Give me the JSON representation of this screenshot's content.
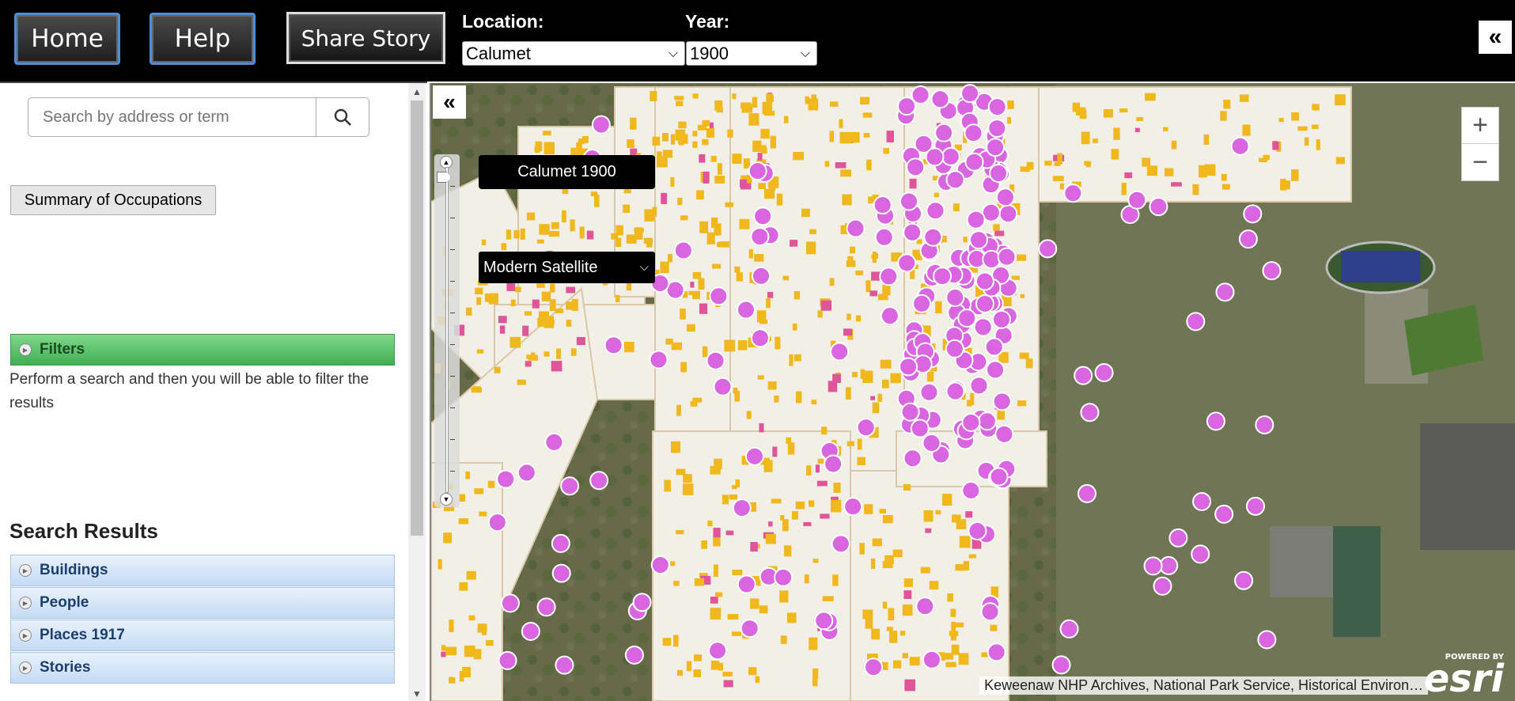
{
  "header": {
    "home_label": "Home",
    "help_label": "Help",
    "share_label": "Share Story",
    "location_label": "Location:",
    "location_value": "Calumet",
    "year_label": "Year:",
    "year_value": "1900",
    "collapse_icon": "double-chevron-left-icon"
  },
  "sidebar": {
    "search_placeholder": "Search by address or term",
    "summary_button": "Summary of Occupations",
    "filters_label": "Filters",
    "filters_message": "Perform a search and then you will be able to filter the results",
    "results_title": "Search Results",
    "result_sections": [
      "Buildings",
      "People",
      "Places 1917",
      "Stories"
    ]
  },
  "map": {
    "map_label": "Calumet 1900",
    "basemap_value": "Modern Satellite",
    "attribution": "Keweenaw NHP Archives, National Park Service, Historical Environ…",
    "esri_small": "POWERED BY",
    "esri_big": "esri",
    "zoom_in": "+",
    "zoom_out": "−",
    "marker_color": "#d966e0",
    "building_color": "#f0b81c"
  }
}
